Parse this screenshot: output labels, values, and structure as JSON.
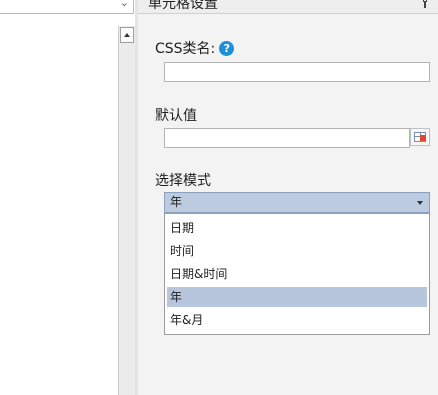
{
  "panel": {
    "title": "单元格设置"
  },
  "css_class": {
    "label": "CSS类名:",
    "help_symbol": "?",
    "value": ""
  },
  "default_value": {
    "label": "默认值",
    "value": ""
  },
  "select_mode": {
    "label": "选择模式",
    "selected": "年",
    "options": [
      "日期",
      "时间",
      "日期&时间",
      "年",
      "年&月"
    ],
    "highlighted_index": 3
  },
  "icons": {
    "help": "help-icon",
    "pin": "pin-icon",
    "picker": "date-picker-icon",
    "dropdown": "chevron-down-icon"
  },
  "colors": {
    "help_icon": "#1e8fd6",
    "selection": "#b7c6dd",
    "select_box": "#bccbe0"
  }
}
